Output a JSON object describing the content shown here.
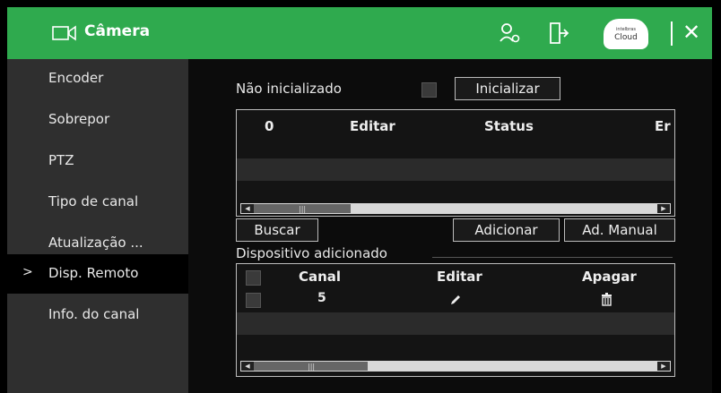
{
  "window": {
    "title": "Câmera",
    "cloud_label_small": "intelbras",
    "cloud_label": "Cloud"
  },
  "sidebar": {
    "items": [
      {
        "label": "Encoder"
      },
      {
        "label": "Sobrepor"
      },
      {
        "label": "PTZ"
      },
      {
        "label": "Tipo de canal"
      },
      {
        "label": "Atualização ..."
      },
      {
        "label": "Disp. Remoto",
        "active": true
      },
      {
        "label": "Info. do canal"
      }
    ],
    "active_marker": ">"
  },
  "init": {
    "status_text": "Não inicializado",
    "button": "Inicializar"
  },
  "search_table": {
    "headers": [
      "0",
      "Editar",
      "Status",
      "Er"
    ]
  },
  "actions": {
    "search": "Buscar",
    "add": "Adicionar",
    "manual_add": "Ad. Manual"
  },
  "added_section": {
    "title": "Dispositivo adicionado"
  },
  "added_table": {
    "headers": [
      "Canal",
      "Editar",
      "Apagar"
    ],
    "rows": [
      {
        "canal": "5"
      }
    ]
  },
  "colors": {
    "accent": "#2faa4e",
    "sidebar_bg": "#2f2f2f",
    "content_bg": "#0c0c0c"
  }
}
